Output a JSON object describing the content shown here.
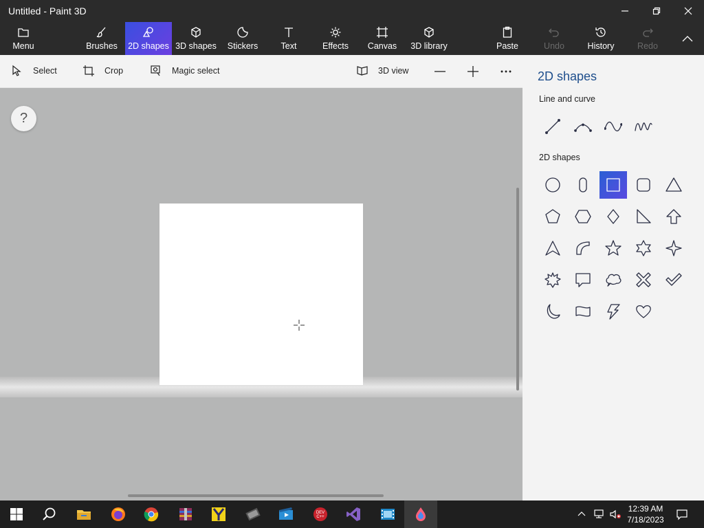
{
  "window": {
    "title": "Untitled - Paint 3D"
  },
  "ribbon": {
    "menu": "Menu",
    "tabs": [
      {
        "label": "Brushes",
        "icon": "brush-icon"
      },
      {
        "label": "2D shapes",
        "icon": "2d-shapes-icon",
        "active": true
      },
      {
        "label": "3D shapes",
        "icon": "cube-icon"
      },
      {
        "label": "Stickers",
        "icon": "sticker-icon"
      },
      {
        "label": "Text",
        "icon": "text-icon"
      },
      {
        "label": "Effects",
        "icon": "sun-icon"
      },
      {
        "label": "Canvas",
        "icon": "canvas-icon"
      },
      {
        "label": "3D library",
        "icon": "library-icon"
      }
    ],
    "actions": [
      {
        "label": "Paste",
        "icon": "clipboard-icon",
        "enabled": true
      },
      {
        "label": "Undo",
        "icon": "undo-icon",
        "enabled": false
      },
      {
        "label": "History",
        "icon": "history-icon",
        "enabled": true
      },
      {
        "label": "Redo",
        "icon": "redo-icon",
        "enabled": false
      }
    ]
  },
  "toolbar": {
    "select": "Select",
    "crop": "Crop",
    "magic_select": "Magic select",
    "view_3d": "3D view"
  },
  "workspace": {
    "help": "?"
  },
  "panel": {
    "title": "2D shapes",
    "line_section": "Line and curve",
    "shapes_section": "2D shapes",
    "lines": [
      "line-icon",
      "curve-icon",
      "wave-curve-icon",
      "polyline-curve-icon"
    ],
    "shapes": [
      "circle-icon",
      "capsule-icon",
      "square-icon",
      "rounded-square-icon",
      "triangle-icon",
      "pentagon-icon",
      "hexagon-icon",
      "diamond-icon",
      "right-triangle-icon",
      "arrow-up-icon",
      "arrowhead-icon",
      "quarter-circle-icon",
      "five-point-star-icon",
      "six-point-star-icon",
      "four-point-star-icon",
      "burst-icon",
      "speech-bubble-icon",
      "thought-bubble-icon",
      "x-mark-icon",
      "check-mark-icon",
      "crescent-moon-icon",
      "banner-icon",
      "lightning-icon",
      "heart-icon"
    ],
    "selected_shape": "square-icon",
    "accent": "#3a4fe0"
  },
  "taskbar": {
    "apps": [
      "start-icon",
      "search-icon",
      "file-explorer-icon",
      "firefox-icon",
      "chrome-icon",
      "winrar-icon",
      "app-y-icon",
      "video-editor-icon",
      "movie-maker-icon",
      "dev-cpp-icon",
      "visual-studio-icon",
      "film-icon",
      "paint-3d-icon"
    ],
    "time": "12:39 AM",
    "date": "7/18/2023"
  }
}
